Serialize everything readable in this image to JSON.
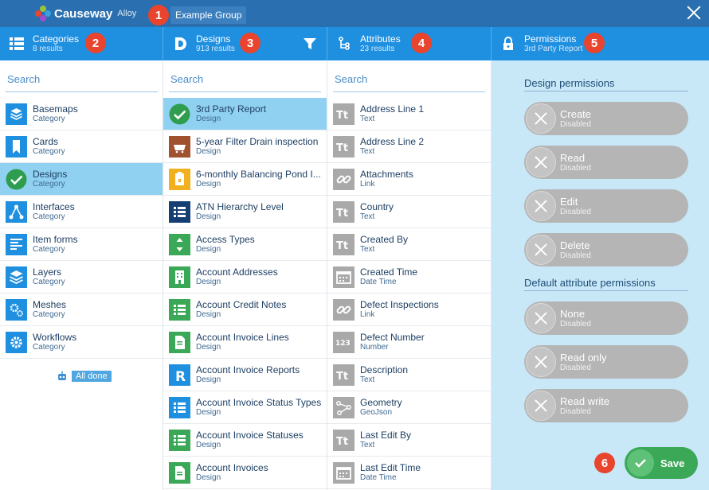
{
  "app": {
    "brand": "Causeway",
    "product": "Alloy",
    "group": "Example Group"
  },
  "badges": [
    "1",
    "2",
    "3",
    "4",
    "5",
    "6"
  ],
  "colors": {
    "header": "#2a6faf",
    "column_header": "#1f8fe0",
    "selected": "#90d0f0",
    "save": "#3aa857",
    "badge": "#e8442e"
  },
  "columns": {
    "categories": {
      "title": "Categories",
      "count": "8 results",
      "search_placeholder": "Search",
      "items": [
        {
          "name": "Basemaps",
          "type": "Category",
          "icon": "layers-stack-icon",
          "color": "#1f8fe0"
        },
        {
          "name": "Cards",
          "type": "Category",
          "icon": "bookmark-icon",
          "color": "#1f8fe0"
        },
        {
          "name": "Designs",
          "type": "Category",
          "icon": "check-circle-icon",
          "color": "#2e9d4e"
        },
        {
          "name": "Interfaces",
          "type": "Category",
          "icon": "network-icon",
          "color": "#1f8fe0"
        },
        {
          "name": "Item forms",
          "type": "Category",
          "icon": "form-icon",
          "color": "#1f8fe0"
        },
        {
          "name": "Layers",
          "type": "Category",
          "icon": "layers-icon",
          "color": "#1f8fe0"
        },
        {
          "name": "Meshes",
          "type": "Category",
          "icon": "gears-icon",
          "color": "#1f8fe0"
        },
        {
          "name": "Workflows",
          "type": "Category",
          "icon": "gear-icon",
          "color": "#1f8fe0"
        }
      ],
      "status": "All done"
    },
    "designs": {
      "title": "Designs",
      "count": "913 results",
      "search_placeholder": "Search",
      "items": [
        {
          "name": "3rd Party Report",
          "type": "Design",
          "icon": "check-circle-icon",
          "color": "#2e9d4e"
        },
        {
          "name": "5-year Filter Drain inspection",
          "type": "Design",
          "icon": "drain-icon",
          "color": "#a0522d"
        },
        {
          "name": "6-monthly Balancing Pond I...",
          "type": "Design",
          "icon": "clipboard-icon",
          "color": "#f2b01e"
        },
        {
          "name": "ATN Hierarchy Level",
          "type": "Design",
          "icon": "list-icon",
          "color": "#153f73"
        },
        {
          "name": "Access Types",
          "type": "Design",
          "icon": "arrows-vertical-icon",
          "color": "#3aa857"
        },
        {
          "name": "Account Addresses",
          "type": "Design",
          "icon": "building-icon",
          "color": "#3aa857"
        },
        {
          "name": "Account Credit Notes",
          "type": "Design",
          "icon": "list-icon",
          "color": "#3aa857"
        },
        {
          "name": "Account Invoice Lines",
          "type": "Design",
          "icon": "document-icon",
          "color": "#3aa857"
        },
        {
          "name": "Account Invoice Reports",
          "type": "Design",
          "icon": "r-letter-icon",
          "color": "#1f8fe0"
        },
        {
          "name": "Account Invoice Status Types",
          "type": "Design",
          "icon": "list-icon",
          "color": "#1f8fe0"
        },
        {
          "name": "Account Invoice Statuses",
          "type": "Design",
          "icon": "list-icon",
          "color": "#3aa857"
        },
        {
          "name": "Account Invoices",
          "type": "Design",
          "icon": "document-icon",
          "color": "#3aa857"
        }
      ]
    },
    "attributes": {
      "title": "Attributes",
      "count": "23 results",
      "search_placeholder": "Search",
      "items": [
        {
          "name": "Address Line 1",
          "type": "Text",
          "icon": "text-type-icon"
        },
        {
          "name": "Address Line 2",
          "type": "Text",
          "icon": "text-type-icon"
        },
        {
          "name": "Attachments",
          "type": "Link",
          "icon": "link-icon"
        },
        {
          "name": "Country",
          "type": "Text",
          "icon": "text-type-icon"
        },
        {
          "name": "Created By",
          "type": "Text",
          "icon": "text-type-icon"
        },
        {
          "name": "Created Time",
          "type": "Date Time",
          "icon": "calendar-icon"
        },
        {
          "name": "Defect Inspections",
          "type": "Link",
          "icon": "link-icon"
        },
        {
          "name": "Defect Number",
          "type": "Number",
          "icon": "number-icon"
        },
        {
          "name": "Description",
          "type": "Text",
          "icon": "text-type-icon"
        },
        {
          "name": "Geometry",
          "type": "GeoJson",
          "icon": "geometry-icon"
        },
        {
          "name": "Last Edit By",
          "type": "Text",
          "icon": "text-type-icon"
        },
        {
          "name": "Last Edit Time",
          "type": "Date Time",
          "icon": "calendar-icon"
        }
      ],
      "text_glyph": "Tt",
      "number_glyph": "123"
    },
    "permissions": {
      "title": "Permissions",
      "subtitle": "3rd Party Report",
      "design_section": "Design permissions",
      "design_toggles": [
        {
          "label": "Create",
          "state": "Disabled"
        },
        {
          "label": "Read",
          "state": "Disabled"
        },
        {
          "label": "Edit",
          "state": "Disabled"
        },
        {
          "label": "Delete",
          "state": "Disabled"
        }
      ],
      "attribute_section": "Default attribute permissions",
      "attribute_toggles": [
        {
          "label": "None",
          "state": "Disabled"
        },
        {
          "label": "Read only",
          "state": "Disabled"
        },
        {
          "label": "Read write",
          "state": "Disabled"
        }
      ],
      "save_label": "Save"
    }
  }
}
